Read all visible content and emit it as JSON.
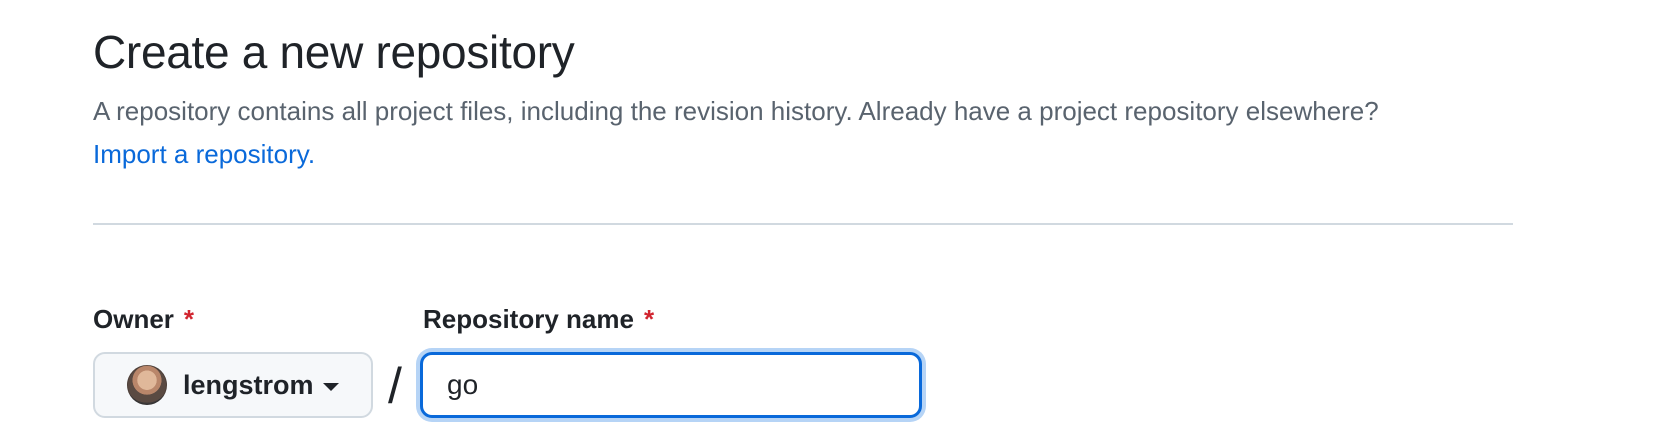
{
  "header": {
    "title": "Create a new repository",
    "description": "A repository contains all project files, including the revision history. Already have a project repository elsewhere?",
    "import_link": "Import a repository."
  },
  "form": {
    "owner": {
      "label": "Owner",
      "required_marker": "*",
      "selected": "lengstrom",
      "avatar_icon": "user-avatar"
    },
    "separator": "/",
    "repository": {
      "label": "Repository name",
      "required_marker": "*",
      "value": "go"
    }
  },
  "colors": {
    "text": "#1f2328",
    "muted": "#59636e",
    "link": "#0969da",
    "required": "#d1242f",
    "focus_ring": "#b6d4f6"
  }
}
